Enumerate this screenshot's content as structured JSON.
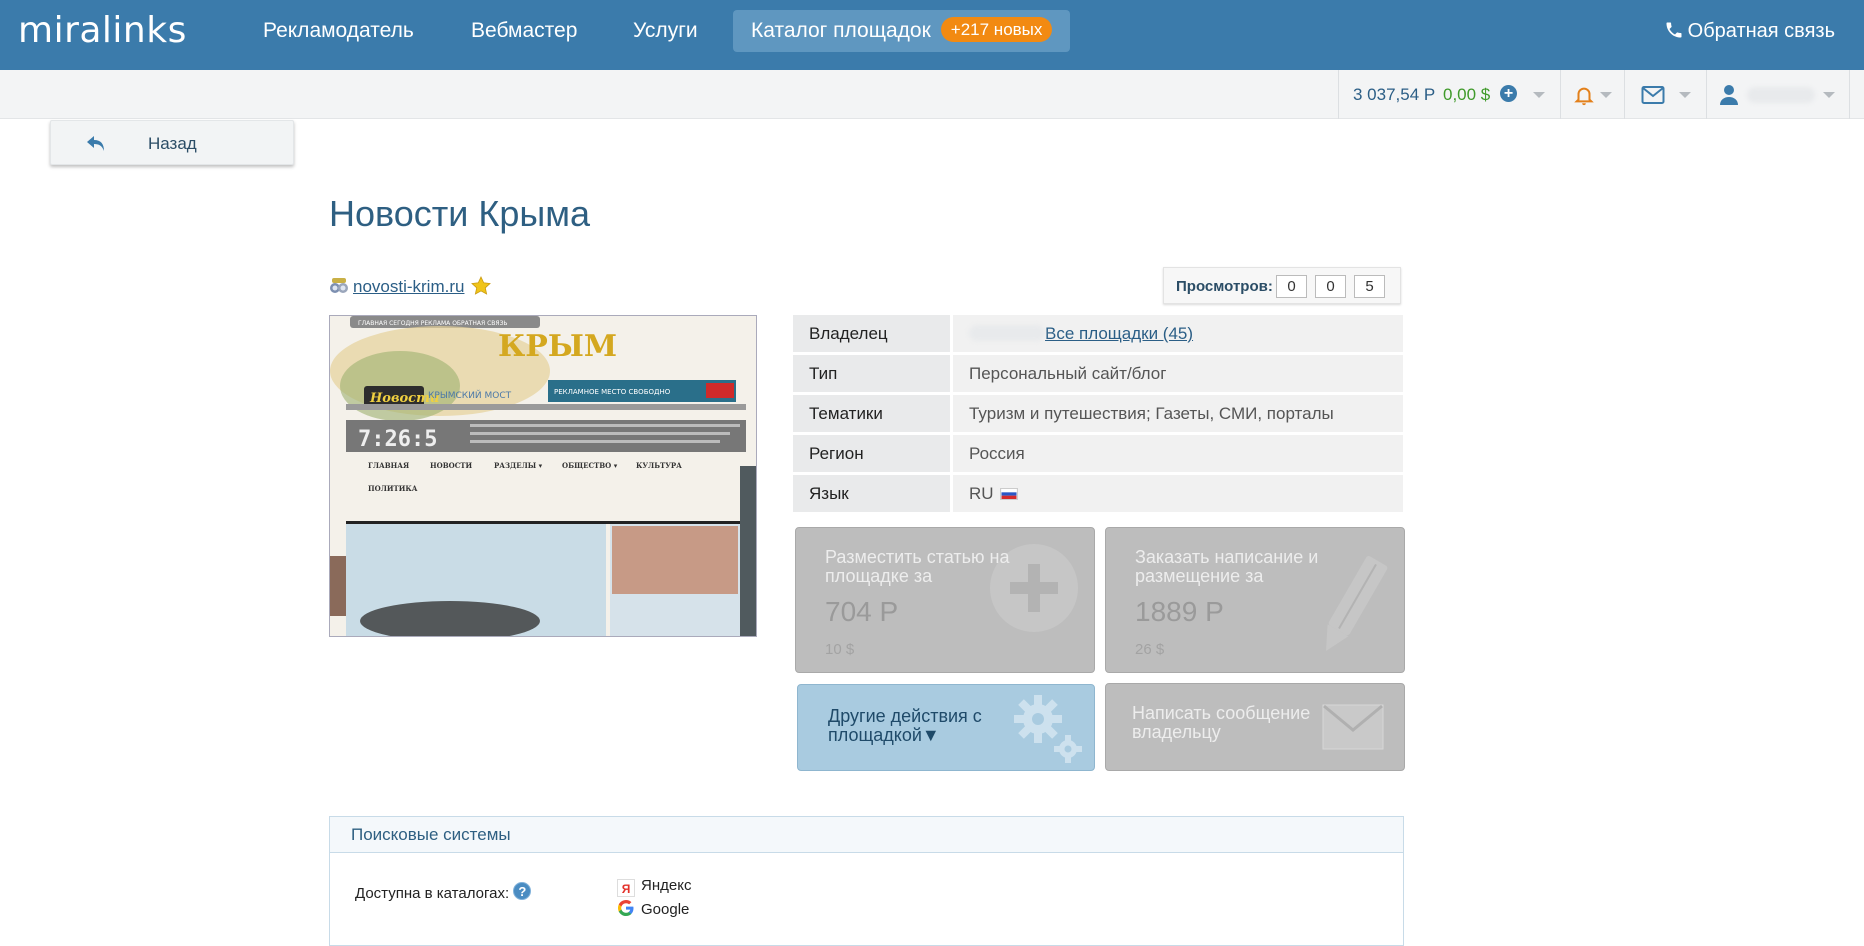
{
  "header": {
    "logo": "miralinks",
    "nav": [
      {
        "label": "Рекламодатель"
      },
      {
        "label": "Вебмастер"
      },
      {
        "label": "Услуги"
      },
      {
        "label": "Каталог площадок",
        "badge": "+217 новых"
      }
    ],
    "feedback": "Обратная связь"
  },
  "account_bar": {
    "balance_rub": "3 037,54 Р",
    "balance_usd": "0,00 $"
  },
  "back_button": "Назад",
  "page_title": "Новости Крыма",
  "site": {
    "domain": "novosti-krim.ru",
    "views_label": "Просмотров:",
    "views_digits": [
      "0",
      "0",
      "5"
    ]
  },
  "screenshot": {
    "topmenu": "ГЛАВНАЯ  СЕГОДНЯ  РЕКЛАМА  ОБРАТНАЯ СВЯЗЬ",
    "brand": "Новости",
    "title": "КРЫМ",
    "bridge": "КРЫМСКИЙ МОСТ",
    "ad": "РЕКЛАМНОЕ МЕСТО СВОБОДНО",
    "clock": "7:26:5",
    "menu": [
      "ГЛАВНАЯ",
      "НОВОСТИ",
      "РАЗДЕЛЫ ▾",
      "ОБЩЕСТВО ▾",
      "КУЛЬТУРА"
    ],
    "menu2": "ПОЛИТИКА"
  },
  "info": [
    {
      "key": "Владелец",
      "link": "Все площадки (45)"
    },
    {
      "key": "Тип",
      "value": "Персональный сайт/блог"
    },
    {
      "key": "Тематики",
      "value": "Туризм и путешествия; Газеты, СМИ, порталы"
    },
    {
      "key": "Регион",
      "value": "Россия"
    },
    {
      "key": "Язык",
      "value": "RU"
    }
  ],
  "actions": {
    "place_article": {
      "title": "Разместить статью на площадке за",
      "price": "704 Р",
      "usd": "10 $"
    },
    "order_writing": {
      "title": "Заказать написание и размещение за",
      "price": "1889 Р",
      "usd": "26 $"
    },
    "other_actions": "Другие действия с площадкой▼",
    "message_owner": "Написать сообщение владельцу"
  },
  "search_systems": {
    "heading": "Поисковые системы",
    "catalogs_label": "Доступна в каталогах:",
    "engines": [
      "Яндекс",
      "Google"
    ]
  },
  "colors": {
    "header_bg": "#3b7bab",
    "badge": "#f28a12",
    "usd_green": "#3f9a2a",
    "bell_orange": "#e3801b"
  }
}
